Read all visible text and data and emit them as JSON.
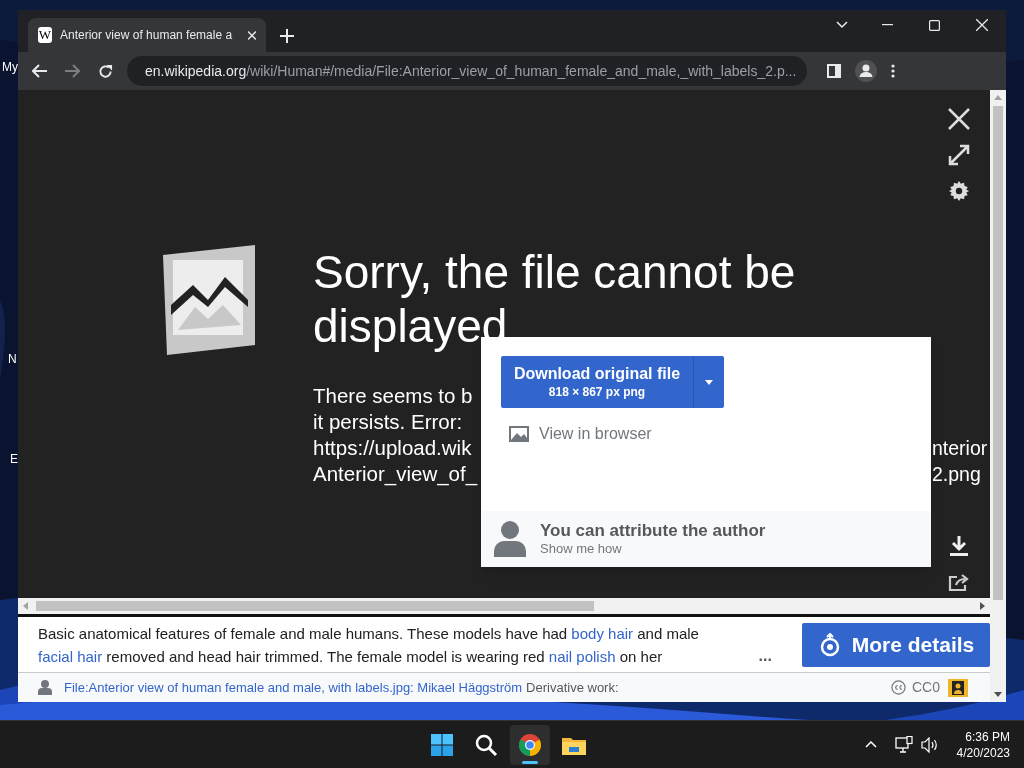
{
  "desktop": {
    "icon_labels": [
      "My",
      "N",
      "E"
    ]
  },
  "browser": {
    "tab": {
      "favicon": "W",
      "title": "Anterior view of human female a",
      "selected": true
    },
    "address": {
      "domain": "en.wikipedia.org",
      "path": "/wiki/Human#/media/File:Anterior_view_of_human_female_and_male,_with_labels_2.p..."
    }
  },
  "media_viewer": {
    "heading": "Sorry, the file cannot be displayed",
    "message_lines": [
      {
        "left": "There seems to b"
      },
      {
        "left": "it persists. Error: "
      },
      {
        "left": "https://upload.wik",
        "right": "nterior"
      },
      {
        "left": "Anterior_view_of_",
        "right": "2.png"
      }
    ],
    "popup": {
      "download": {
        "label": "Download original file",
        "detail": "818 × 867 px png"
      },
      "view_in_browser": "View in browser",
      "attribution": {
        "title": "You can attribute the author",
        "link": "Show me how"
      }
    }
  },
  "caption": {
    "description": [
      {
        "text": "Basic anatomical features of female and male humans. These models have had ",
        "link": false
      },
      {
        "text": "body hair",
        "link": true
      },
      {
        "text": " and male ",
        "link": false
      },
      {
        "text": "facial hair",
        "link": true
      },
      {
        "text": " removed and head hair trimmed. The female model is wearing red ",
        "link": false
      },
      {
        "text": "nail polish",
        "link": true
      },
      {
        "text": " on her",
        "link": false
      }
    ],
    "more_text": "...",
    "more_button": "More details",
    "author_link": "File:Anterior view of human female and male, with labels.jpg: Mikael Häggström",
    "author_note": "Derivative work:",
    "license": "CC0"
  },
  "taskbar": {
    "apps": [
      {
        "kind": "start",
        "selected": false
      },
      {
        "kind": "search",
        "selected": false
      },
      {
        "kind": "chrome",
        "selected": true
      },
      {
        "kind": "explorer",
        "selected": false
      }
    ],
    "time": "6:36 PM",
    "date": "4/20/2023"
  }
}
